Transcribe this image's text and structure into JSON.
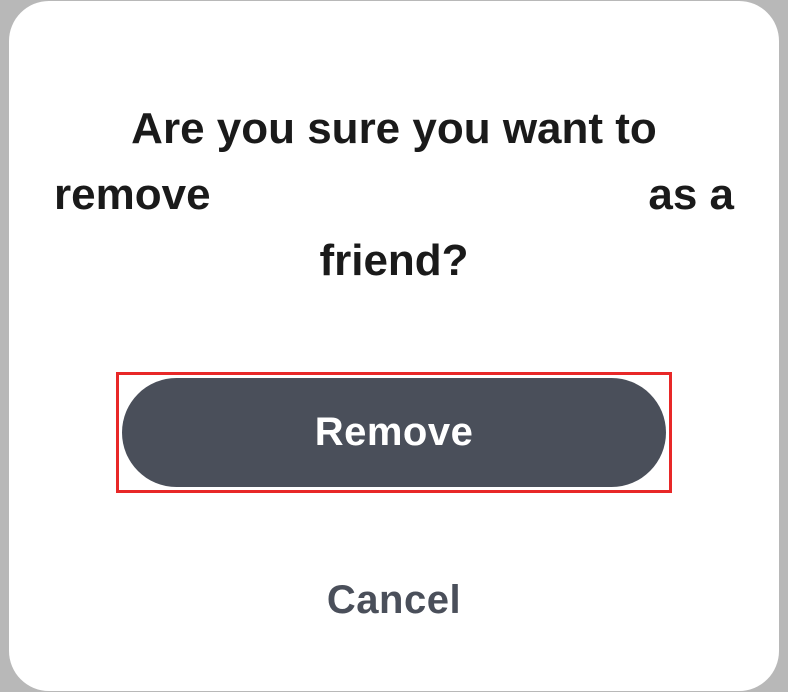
{
  "modal": {
    "title_line1": "Are you sure you want to",
    "title_line2_start": "remove",
    "title_line2_end": "as a",
    "title_line3": "friend?",
    "remove_label": "Remove",
    "cancel_label": "Cancel"
  },
  "colors": {
    "button_bg": "#4a4f5a",
    "highlight_border": "#e82828",
    "text": "#1a1a1a"
  }
}
